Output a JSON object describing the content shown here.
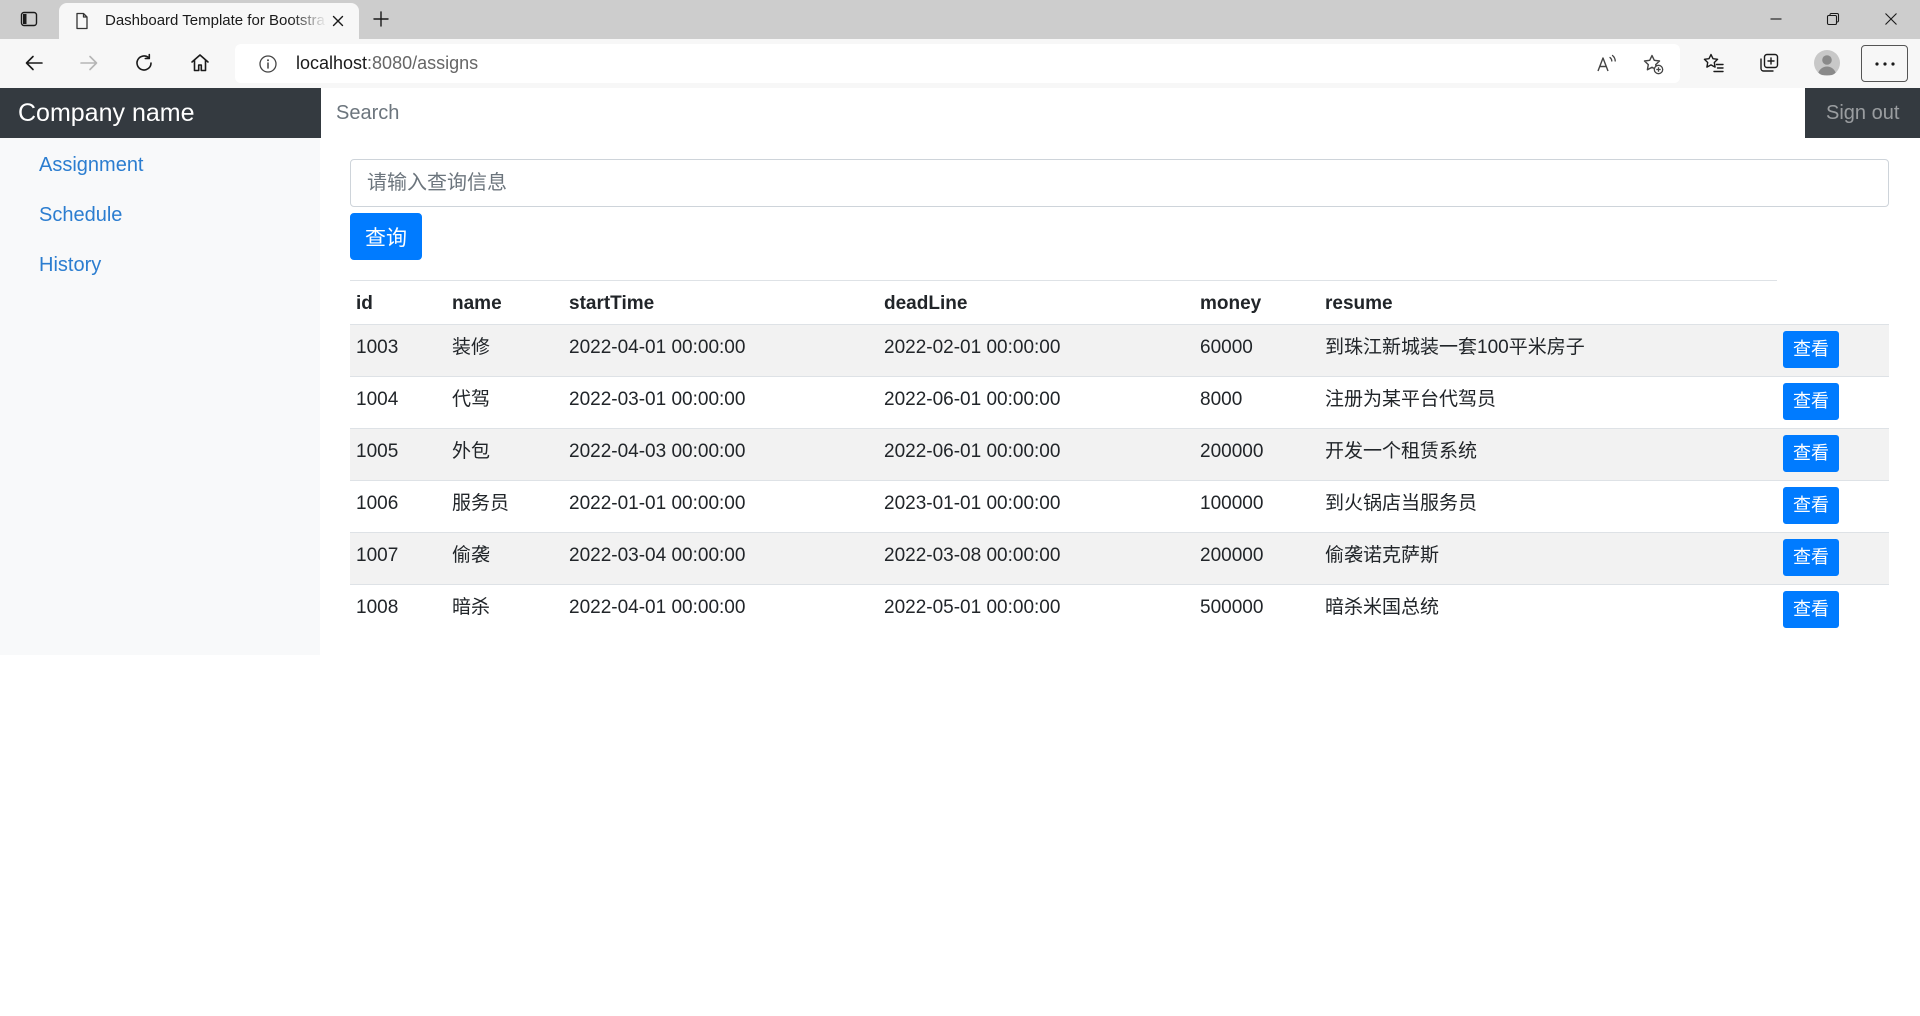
{
  "browser": {
    "tab_title": "Dashboard Template for Bootstra",
    "url_host": "localhost",
    "url_path": ":8080/assigns"
  },
  "navbar": {
    "brand": "Company name",
    "search_placeholder": "Search",
    "signout_label": "Sign out"
  },
  "sidebar": {
    "items": [
      "Assignment",
      "Schedule",
      "History"
    ]
  },
  "query": {
    "placeholder": "请输入查询信息",
    "button_label": "查询"
  },
  "table": {
    "headers": [
      "id",
      "name",
      "startTime",
      "deadLine",
      "money",
      "resume"
    ],
    "action_label": "查看",
    "rows": [
      {
        "id": "1003",
        "name": "装修",
        "startTime": "2022-04-01 00:00:00",
        "deadLine": "2022-02-01 00:00:00",
        "money": "60000",
        "resume": "到珠江新城装一套100平米房子"
      },
      {
        "id": "1004",
        "name": "代驾",
        "startTime": "2022-03-01 00:00:00",
        "deadLine": "2022-06-01 00:00:00",
        "money": "8000",
        "resume": "注册为某平台代驾员"
      },
      {
        "id": "1005",
        "name": "外包",
        "startTime": "2022-04-03 00:00:00",
        "deadLine": "2022-06-01 00:00:00",
        "money": "200000",
        "resume": "开发一个租赁系统"
      },
      {
        "id": "1006",
        "name": "服务员",
        "startTime": "2022-01-01 00:00:00",
        "deadLine": "2023-01-01 00:00:00",
        "money": "100000",
        "resume": "到火锅店当服务员"
      },
      {
        "id": "1007",
        "name": "偷袭",
        "startTime": "2022-03-04 00:00:00",
        "deadLine": "2022-03-08 00:00:00",
        "money": "200000",
        "resume": "偷袭诺克萨斯"
      },
      {
        "id": "1008",
        "name": "暗杀",
        "startTime": "2022-04-01 00:00:00",
        "deadLine": "2022-05-01 00:00:00",
        "money": "500000",
        "resume": "暗杀米国总统"
      }
    ]
  },
  "icons": {
    "tab_actions": "tab-actions-icon",
    "tab_page": "document-icon",
    "tab_close": "close-icon",
    "new_tab": "plus-icon",
    "minimize": "minimize-icon",
    "restore": "restore-icon",
    "window_close": "close-icon",
    "back": "arrow-left-icon",
    "forward": "arrow-right-icon",
    "refresh": "refresh-icon",
    "home": "home-icon",
    "site_info": "info-icon",
    "read_aloud": "read-aloud-icon",
    "add_favorite": "star-add-icon",
    "favorites": "favorites-icon",
    "collections": "collections-icon",
    "profile": "avatar-icon",
    "more": "more-dots-icon"
  },
  "colors": {
    "navbar": "#343a40",
    "sidebar": "#f8f9fa",
    "link": "#2b7dd0",
    "primary": "#007bff",
    "stripe": "#f2f2f2",
    "border": "#dee2e6",
    "text": "#212529"
  }
}
